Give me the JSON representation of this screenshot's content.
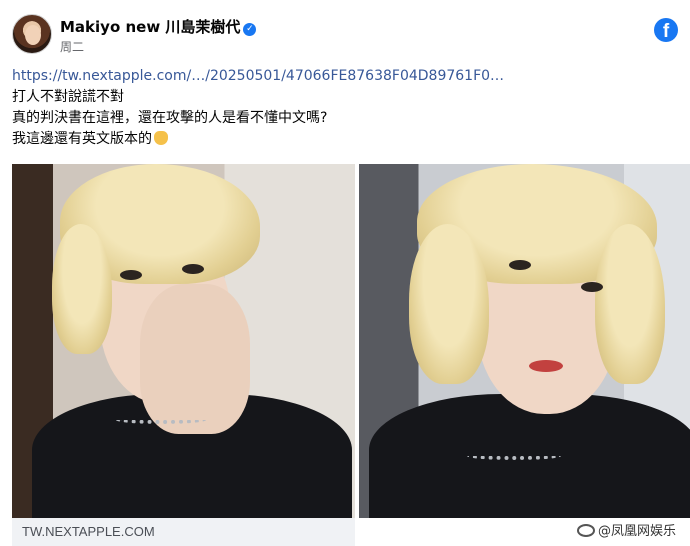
{
  "post": {
    "author": "Makiyo new 川島茉樹代",
    "verified_icon": "verified-badge-icon",
    "time": "周二",
    "link": "https://tw.nextapple.com/…/20250501/47066FE87638F04D89761F0…",
    "lines": [
      "打人不對說謊不對",
      "真的判決書在這裡，還在攻擊的人是看不懂中文嗎?",
      "我這邊還有英文版本的"
    ],
    "emoji": "waving-hand-icon"
  },
  "platform_icon": "facebook-logo-icon",
  "link_preview": {
    "domain": "TW.NEXTAPPLE.COM"
  },
  "watermark": {
    "text": "@凤凰网娱乐",
    "icon": "weibo-logo-icon"
  },
  "colors": {
    "facebook_blue": "#1877f2",
    "link": "#385898",
    "caption_bg": "#f0f2f5"
  }
}
